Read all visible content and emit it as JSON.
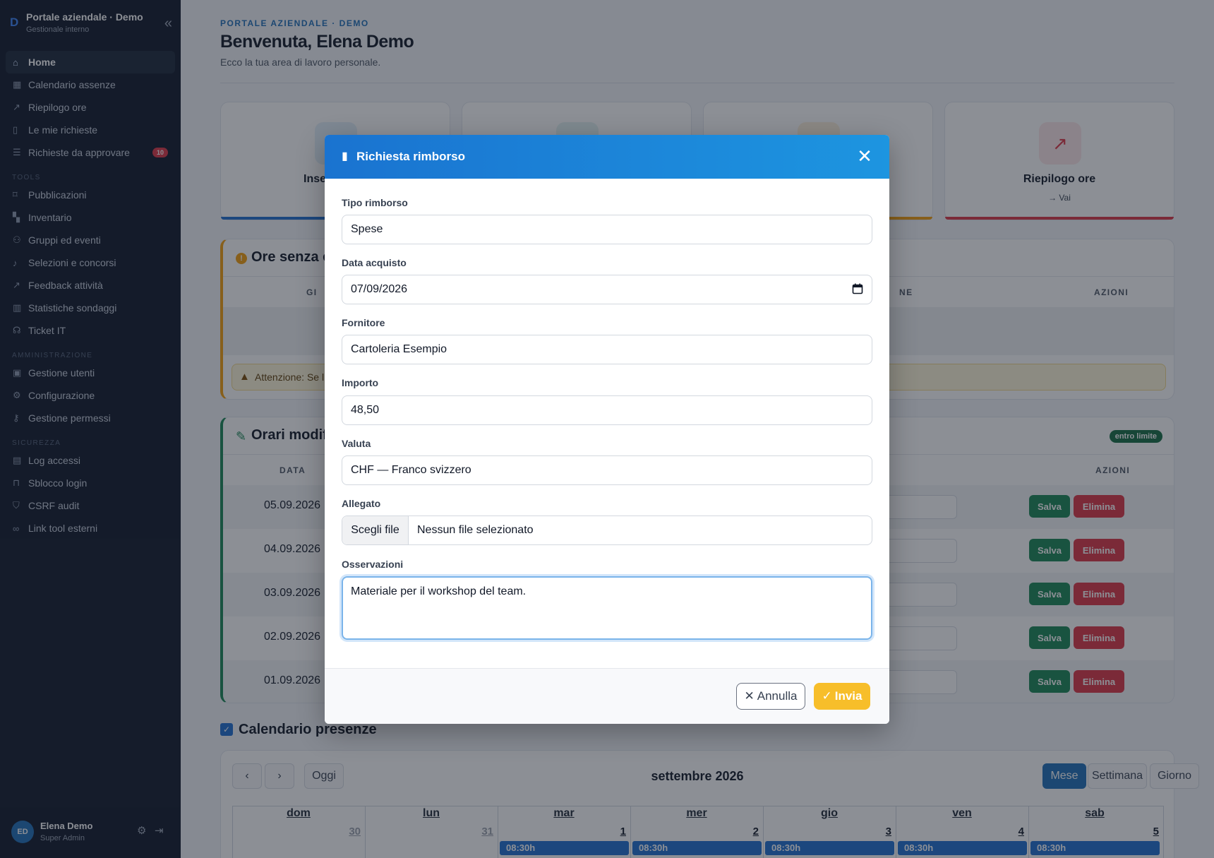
{
  "sidebar": {
    "brand_logo": "D",
    "brand_title": "Portale aziendale · Demo",
    "brand_subtitle": "Gestionale interno",
    "main_items": [
      {
        "label": "Home",
        "icon": "home-icon",
        "active": true
      },
      {
        "label": "Calendario assenze",
        "icon": "calendar-icon"
      },
      {
        "label": "Riepilogo ore",
        "icon": "chart-line-icon"
      },
      {
        "label": "Le mie richieste",
        "icon": "clipboard-icon"
      },
      {
        "label": "Richieste da approvare",
        "icon": "list-check-icon",
        "badge": "10"
      }
    ],
    "section_tools": "TOOLS",
    "tools_items": [
      {
        "label": "Pubblicazioni",
        "icon": "bookmark-icon"
      },
      {
        "label": "Inventario",
        "icon": "boxes-icon"
      },
      {
        "label": "Gruppi ed eventi",
        "icon": "people-icon"
      },
      {
        "label": "Selezioni e concorsi",
        "icon": "music-icon"
      },
      {
        "label": "Feedback attività",
        "icon": "chart-line-icon"
      },
      {
        "label": "Statistiche sondaggi",
        "icon": "bar-chart-icon"
      },
      {
        "label": "Ticket IT",
        "icon": "headset-icon"
      }
    ],
    "section_admin": "AMMINISTRAZIONE",
    "admin_items": [
      {
        "label": "Gestione utenti",
        "icon": "user-icon"
      },
      {
        "label": "Configurazione",
        "icon": "gear-icon"
      },
      {
        "label": "Gestione permessi",
        "icon": "key-icon"
      }
    ],
    "section_security": "SICUREZZA",
    "security_items": [
      {
        "label": "Log accessi",
        "icon": "document-icon"
      },
      {
        "label": "Sblocco login",
        "icon": "unlock-icon"
      },
      {
        "label": "CSRF audit",
        "icon": "shield-icon"
      },
      {
        "label": "Link tool esterni",
        "icon": "link-icon"
      }
    ],
    "user": {
      "initials": "ED",
      "name": "Elena Demo",
      "role": "Super Admin"
    }
  },
  "header": {
    "eyebrow": "PORTALE AZIENDALE · DEMO",
    "title": "Benvenuta, Elena Demo",
    "lead": "Ecco la tua area di lavoro personale."
  },
  "quick_cards": [
    {
      "title": "Inse",
      "link": "",
      "bar_color": "#1f6fd0",
      "icon_bg": "#e3f1fb"
    },
    {
      "title": "",
      "link": "",
      "bar_color": "#198754",
      "icon_bg": "#e2f3f2"
    },
    {
      "title": "",
      "link": "",
      "bar_color": "#f59e0b",
      "icon_bg": "#fdf0dc"
    },
    {
      "title": "Riepilogo ore",
      "link": "→ Vai",
      "bar_color": "#dc3545",
      "icon_bg": "#fde7e8"
    }
  ],
  "panel_ore": {
    "title": "Ore senza c",
    "col_left": "GI",
    "col_mid": "NE",
    "col_actions": "AZIONI",
    "alert": "Attenzione: Se l"
  },
  "panel_orari": {
    "title": "Orari modif",
    "badge": "entro limite",
    "col_date": "DATA",
    "col_actions": "AZIONI",
    "rows": [
      {
        "date": "05.09.2026"
      },
      {
        "date": "04.09.2026"
      },
      {
        "date": "03.09.2026"
      },
      {
        "date": "02.09.2026"
      },
      {
        "date": "01.09.2026"
      }
    ],
    "save_label": "Salva",
    "delete_label": "Elimina"
  },
  "calendar": {
    "title": "Calendario presenze",
    "today_label": "Oggi",
    "month_label": "settembre 2026",
    "views": [
      "Mese",
      "Settimana",
      "Giorno"
    ],
    "days": [
      "dom",
      "lun",
      "mar",
      "mer",
      "gio",
      "ven",
      "sab"
    ],
    "numbers": [
      "30",
      "31",
      "1",
      "2",
      "3",
      "4",
      "5"
    ],
    "event_label": "08:30h"
  },
  "modal": {
    "title": "Richiesta rimborso",
    "fields": {
      "tipo_label": "Tipo rimborso",
      "tipo_value": "Spese",
      "data_label": "Data acquisto",
      "data_value": "07/09/2026",
      "fornitore_label": "Fornitore",
      "fornitore_value": "Cartoleria Esempio",
      "importo_label": "Importo",
      "importo_value": "48,50",
      "valuta_label": "Valuta",
      "valuta_value": "CHF — Franco svizzero",
      "allegato_label": "Allegato",
      "file_button": "Scegli file",
      "file_status": "Nessun file selezionato",
      "osservazioni_label": "Osservazioni",
      "osservazioni_value": "Materiale per il workshop del team."
    },
    "cancel_label": "Annulla",
    "submit_label": "Invia"
  }
}
